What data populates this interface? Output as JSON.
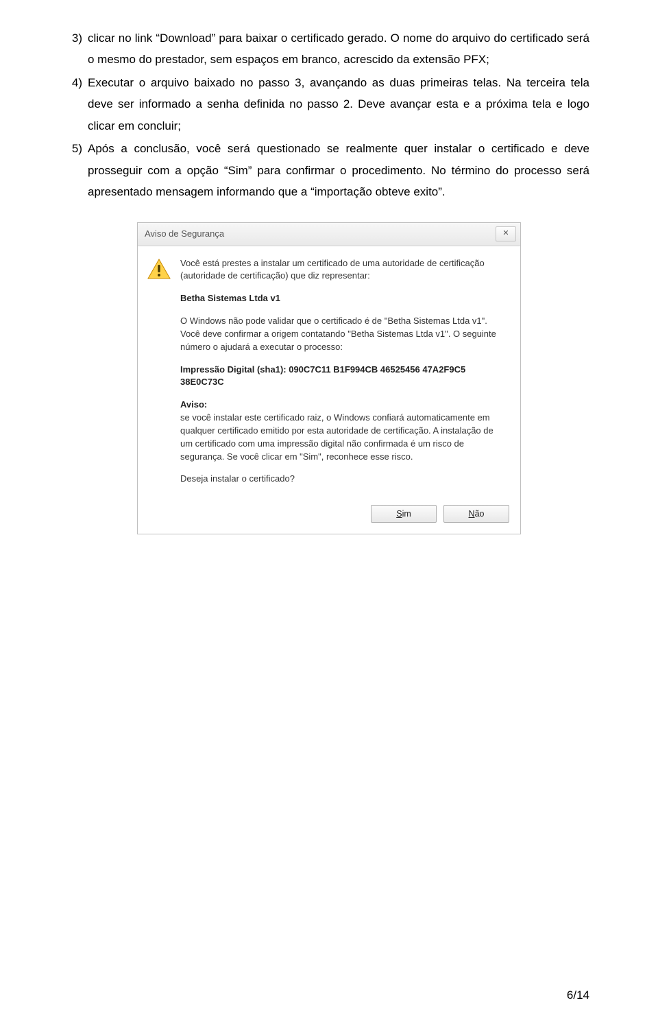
{
  "list": {
    "item3": {
      "num": "3)",
      "text": "clicar no link “Download” para baixar o certificado gerado. O nome do arquivo do certificado será o mesmo do prestador, sem espaços em branco, acrescido da extensão PFX;"
    },
    "item4": {
      "num": "4)",
      "text": "Executar o arquivo baixado no passo 3, avançando as duas primeiras telas. Na terceira tela deve ser informado a senha definida no passo 2. Deve avançar esta e a próxima tela e logo clicar em concluir;"
    },
    "item5": {
      "num": "5)",
      "text": "Após a conclusão, você será questionado se realmente quer instalar o certificado e deve prosseguir com a opção “Sim” para confirmar o procedimento. No término do processo será apresentado mensagem informando que a “importação obteve exito”."
    }
  },
  "dialog": {
    "title": "Aviso de Segurança",
    "close_symbol": "✕",
    "p1": "Você está prestes a instalar um certificado de uma autoridade de certificação (autoridade de certificação) que diz representar:",
    "issuer": "Betha Sistemas Ltda v1",
    "p2": "O Windows não pode validar que o certificado é de \"Betha Sistemas Ltda v1\". Você deve confirmar a origem contatando \"Betha Sistemas Ltda v1\". O seguinte número o ajudará a executar o processo:",
    "thumb": "Impressão Digital (sha1): 090C7C11 B1F994CB 46525456 47A2F9C5 38E0C73C",
    "aviso_label": "Aviso:",
    "aviso_body": "se você instalar este certificado raiz, o Windows confiará automaticamente em qualquer certificado emitido por esta autoridade de certificação. A instalação de um certificado com uma impressão digital não confirmada é um risco de segurança. Se você clicar em \"Sim\", reconhece esse risco.",
    "question": "Deseja instalar o certificado?",
    "yes_underline": "S",
    "yes_rest": "im",
    "no_underline": "N",
    "no_rest": "ão"
  },
  "footer": "6/14"
}
